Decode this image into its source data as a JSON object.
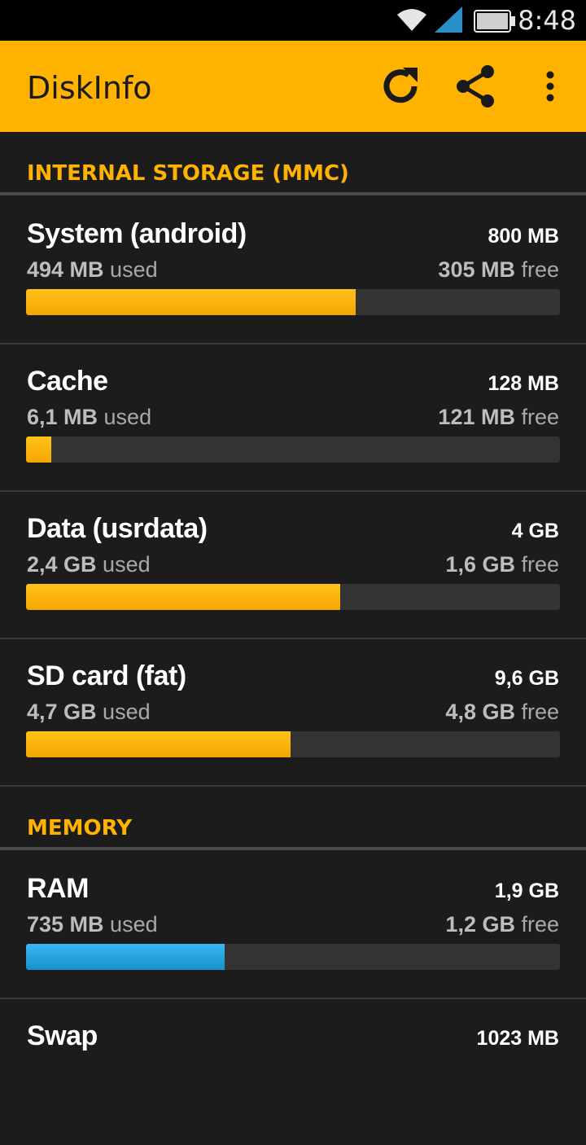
{
  "status_bar": {
    "time": "8:48"
  },
  "app_bar": {
    "title": "DiskInfo",
    "actions": [
      "refresh-icon",
      "share-icon",
      "overflow-menu-icon"
    ]
  },
  "colors": {
    "accent": "#ffb300",
    "ram_bar": "#1e9fdc",
    "background": "#1c1c1c"
  },
  "sections": [
    {
      "title": "INTERNAL STORAGE (MMC)",
      "items": [
        {
          "name": "System (android)",
          "total": "800 MB",
          "used_value": "494 MB",
          "used_suffix": " used",
          "free_value": "305 MB",
          "free_suffix": " free",
          "usage": 0.618
        },
        {
          "name": "Cache",
          "total": "128 MB",
          "used_value": "6,1 MB",
          "used_suffix": " used",
          "free_value": "121 MB",
          "free_suffix": " free",
          "usage": 0.048
        },
        {
          "name": "Data (usrdata)",
          "total": "4 GB",
          "used_value": "2,4 GB",
          "used_suffix": " used",
          "free_value": "1,6 GB",
          "free_suffix": " free",
          "usage": 0.588
        },
        {
          "name": "SD card (fat)",
          "total": "9,6 GB",
          "used_value": "4,7 GB",
          "used_suffix": " used",
          "free_value": "4,8 GB",
          "free_suffix": " free",
          "usage": 0.496
        }
      ]
    },
    {
      "title": "MEMORY",
      "items": [
        {
          "name": "RAM",
          "total": "1,9 GB",
          "used_value": "735 MB",
          "used_suffix": " used",
          "free_value": "1,2 GB",
          "free_suffix": " free",
          "usage": 0.372
        },
        {
          "name": "Swap",
          "total": "1023 MB"
        }
      ]
    }
  ]
}
